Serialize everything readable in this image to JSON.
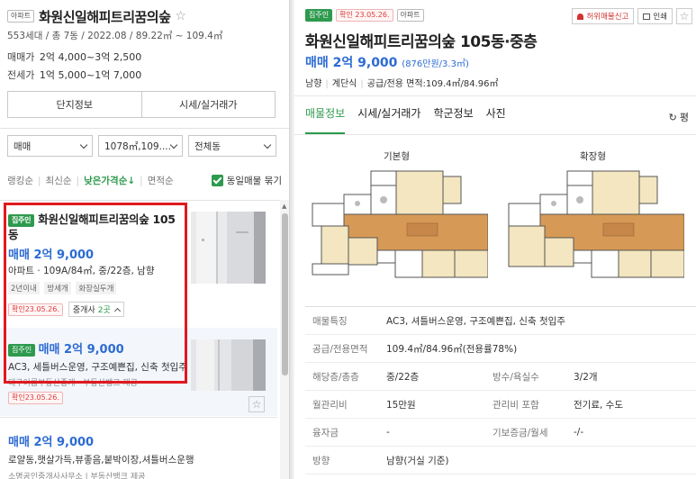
{
  "complex": {
    "tag": "아파트",
    "name": "화원신일해피트리꿈의숲",
    "meta": "553세대 / 총 7동 / 2022.08 / 89.22㎡ ~ 109.4㎡",
    "sale_label": "매매가",
    "sale_value": "2억 4,000~3억 2,500",
    "jeonse_label": "전세가",
    "jeonse_value": "1억 5,000~1억 7,000",
    "btn_info": "단지정보",
    "btn_price": "시세/실거래가"
  },
  "filters": {
    "trade": "매매",
    "area": "1078㎡,109....",
    "dong": "전체동"
  },
  "sort": {
    "items": [
      "랭킹순",
      "최신순",
      "낮은가격순↓",
      "면적순"
    ],
    "active_index": 2,
    "same_listing": "동일매물 묶기"
  },
  "listings": [
    {
      "badge": "집주인",
      "title_line1": "화원신일해피트리꿈의숲 105",
      "title_line2": "동",
      "price": "매매 2억 9,000",
      "desc": "아파트 · 109A/84㎡, 중/22층, 남향",
      "chips": [
        "2년이내",
        "방세개",
        "화장실두개"
      ],
      "confirm": "확인23.05.26.",
      "agents_label": "중개사 ",
      "agents_count": "2곳"
    },
    {
      "badge": "집주인",
      "price": "매매 2억 9,000",
      "desc": "AC3, 세틀버스운영, 구조예쁜집, 신축 첫입주",
      "sub": "대구이롭부동산중개 · 부동산뱅크 제공",
      "confirm": "확인23.05.26."
    },
    {
      "price": "매매 2억 9,000",
      "desc": "로얄동,햇살가득,뷰좋음,붙박이장,셔틀버스운행",
      "sub": "소명공인중개사사무소 | 부동산뱅크 제공"
    }
  ],
  "detail": {
    "badge": "집주인",
    "confirm": "확인 23.05.26.",
    "type_tag": "아파트",
    "report": "허위매물신고",
    "print": "인쇄",
    "title": "화원신일해피트리꿈의숲 105동·중층",
    "price": "매매 2억 9,000",
    "price_unit": "(876만원/3.3㎡)",
    "specs": [
      "남향",
      "계단식",
      "공급/전용 면적:109.4㎡/84.96㎡"
    ],
    "tabs": [
      "매물정보",
      "시세/실거래가",
      "학군정보",
      "사진"
    ],
    "more": "평",
    "fp_basic": "기본형",
    "fp_extended": "확장형"
  },
  "info": {
    "feature_k": "매물특징",
    "feature_v": "AC3, 셔틀버스운영, 구조예쁜집, 신축 첫입주",
    "area_k": "공급/전용면적",
    "area_v": "109.4㎡/84.96㎡(전용률78%)",
    "floor_k": "해당층/총층",
    "floor_v": "중/22층",
    "rooms_k": "방수/욕실수",
    "rooms_v": "3/2개",
    "mgmt_k": "월관리비",
    "mgmt_v": "15만원",
    "mgmt_inc_k": "관리비 포함",
    "mgmt_inc_v": "전기료, 수도",
    "loan_k": "융자금",
    "loan_v": "-",
    "deposit_k": "기보증금/월세",
    "deposit_v": "-/-",
    "dir_k": "방향",
    "dir_v": "남향(거실 기준)"
  },
  "colors": {
    "accent_green": "#2e9a4e",
    "price_blue": "#2c6bd3",
    "highlight_red": "#e0191f"
  }
}
